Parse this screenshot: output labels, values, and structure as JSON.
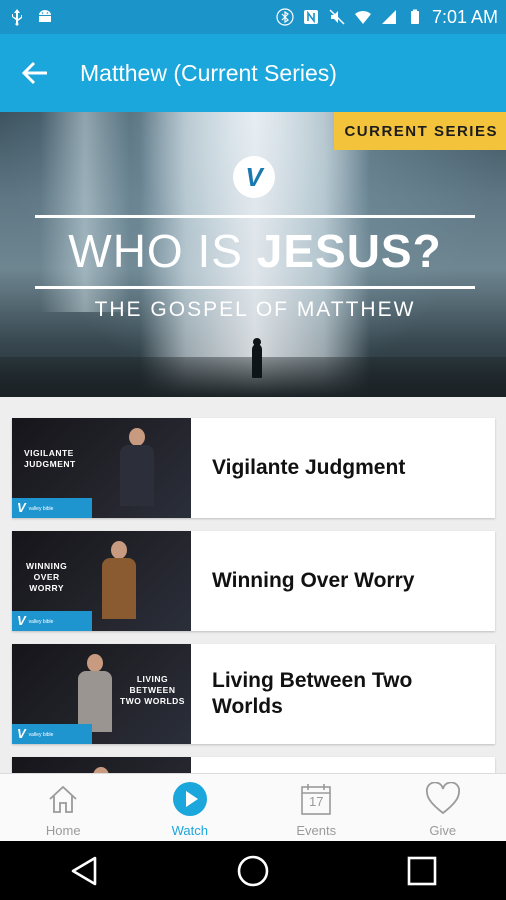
{
  "status_bar": {
    "time": "7:01 AM"
  },
  "header": {
    "title": "Matthew (Current Series)"
  },
  "hero": {
    "badge": "CURRENT SERIES",
    "logo_letter": "V",
    "title_plain": "WHO IS ",
    "title_bold": "JESUS?",
    "subtitle": "THE GOSPEL OF MATTHEW"
  },
  "sermons": [
    {
      "title": "Vigilante Judgment",
      "thumb_text": "VIGILANTE\nJUDGMENT"
    },
    {
      "title": "Winning Over Worry",
      "thumb_text": "WINNING\nOVER\nWORRY"
    },
    {
      "title": "Living Between Two Worlds",
      "thumb_text": "LIVING\nBETWEEN\nTWO WORLDS"
    }
  ],
  "thumb_logo": {
    "letter": "V",
    "small": "valley bible"
  },
  "bottom_nav": {
    "home": "Home",
    "watch": "Watch",
    "events": "Events",
    "events_day": "17",
    "give": "Give"
  },
  "colors": {
    "accent": "#1ba6dc",
    "status_bar": "#1a94c9",
    "badge": "#f2c33b"
  }
}
